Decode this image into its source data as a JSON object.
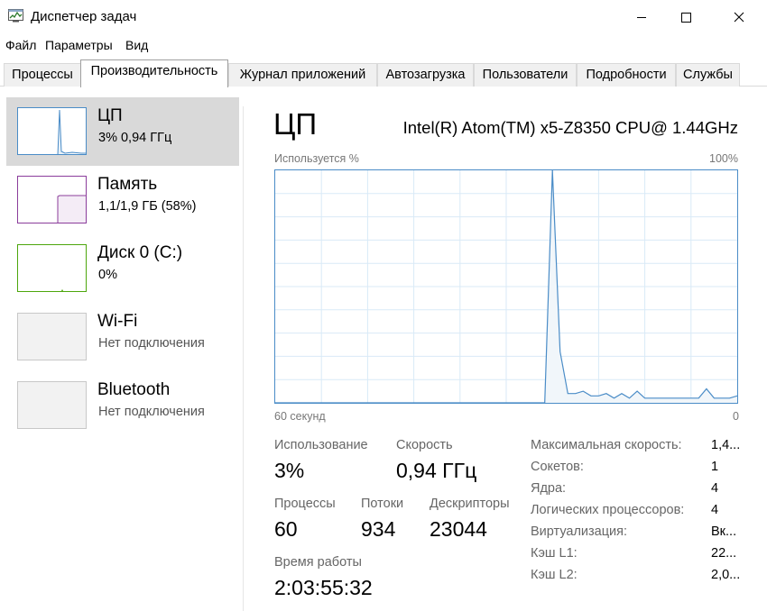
{
  "window": {
    "title": "Диспетчер задач"
  },
  "menu": [
    "Файл",
    "Параметры",
    "Вид"
  ],
  "tabs": [
    "Процессы",
    "Производительность",
    "Журнал приложений",
    "Автозагрузка",
    "Пользователи",
    "Подробности",
    "Службы"
  ],
  "active_tab": "Производительность",
  "devices": [
    {
      "name": "ЦП",
      "sub": "3%  0,94 ГГц",
      "selected": true,
      "color": "#4a8cc7"
    },
    {
      "name": "Память",
      "sub": "1,1/1,9 ГБ (58%)",
      "selected": false,
      "color": "#8b3d9b"
    },
    {
      "name": "Диск 0 (C:)",
      "sub": "0%",
      "selected": false,
      "color": "#4da60c"
    },
    {
      "name": "Wi-Fi",
      "sub": "Нет подключения",
      "selected": false,
      "color": "#c8c8c8"
    },
    {
      "name": "Bluetooth",
      "sub": "Нет подключения",
      "selected": false,
      "color": "#c8c8c8"
    }
  ],
  "cpu": {
    "title": "ЦП",
    "model": "Intel(R) Atom(TM) x5-Z8350 CPU@ 1.44GHz",
    "graph": {
      "y_label": "Используется %",
      "y_max_label": "100%",
      "x_left_label": "60 секунд",
      "x_right_label": "0",
      "accent": "#4a8cc7",
      "fill": "#f1f6fa"
    },
    "stats": {
      "usage_label": "Использование",
      "usage_value": "3%",
      "speed_label": "Скорость",
      "speed_value": "0,94 ГГц",
      "processes_label": "Процессы",
      "processes_value": "60",
      "threads_label": "Потоки",
      "threads_value": "934",
      "handles_label": "Дескрипторы",
      "handles_value": "23044",
      "uptime_label": "Время работы",
      "uptime_value": "2:03:55:32"
    },
    "details": [
      {
        "label": "Максимальная скорость:",
        "value": "1,4..."
      },
      {
        "label": "Сокетов:",
        "value": "1"
      },
      {
        "label": "Ядра:",
        "value": "4"
      },
      {
        "label": "Логических процессоров:",
        "value": "4"
      },
      {
        "label": "Виртуализация:",
        "value": "Вк..."
      },
      {
        "label": "Кэш L1:",
        "value": "22..."
      },
      {
        "label": "Кэш L2:",
        "value": "2,0..."
      }
    ]
  },
  "chart_data": {
    "type": "area",
    "title": "",
    "xlabel": "60 секунд",
    "ylabel": "Используется %",
    "xlim": [
      60,
      0
    ],
    "ylim": [
      0,
      100
    ],
    "grid": true,
    "x": [
      60,
      59,
      58,
      57,
      56,
      55,
      54,
      53,
      52,
      51,
      50,
      49,
      48,
      47,
      46,
      45,
      44,
      43,
      42,
      41,
      40,
      39,
      38,
      37,
      36,
      35,
      34,
      33,
      32,
      31,
      30,
      29,
      28,
      27,
      26,
      25,
      24,
      23,
      22,
      21,
      20,
      19,
      18,
      17,
      16,
      15,
      14,
      13,
      12,
      11,
      10,
      9,
      8,
      7,
      6,
      5,
      4,
      3,
      2,
      1,
      0
    ],
    "series": [
      {
        "values": [
          0,
          0,
          0,
          0,
          0,
          0,
          0,
          0,
          0,
          0,
          0,
          0,
          0,
          0,
          0,
          0,
          0,
          0,
          0,
          0,
          0,
          0,
          0,
          0,
          0,
          0,
          0,
          0,
          0,
          0,
          0,
          0,
          0,
          0,
          0,
          0,
          100,
          22,
          4,
          4,
          5,
          3,
          3,
          4,
          2,
          4,
          2,
          5,
          2,
          2,
          2,
          2,
          2,
          2,
          2,
          2,
          6,
          2,
          2,
          2,
          3
        ]
      }
    ]
  }
}
